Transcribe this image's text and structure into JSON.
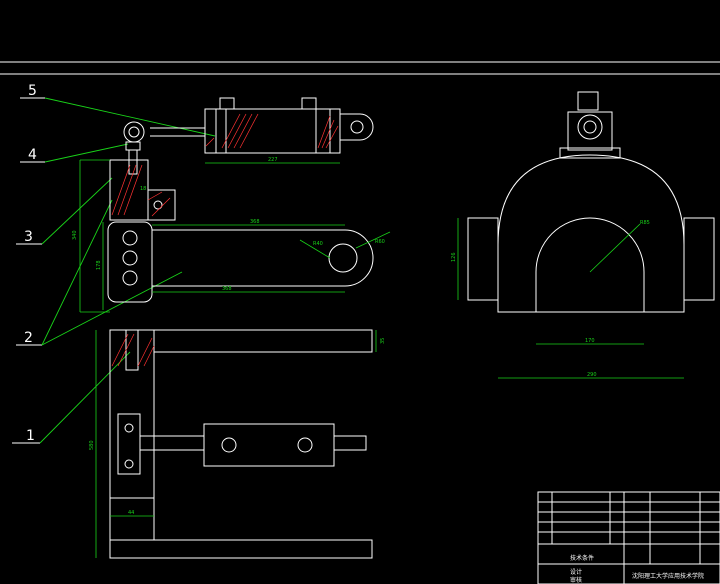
{
  "drawing": {
    "part_labels": [
      "5",
      "4",
      "3",
      "2",
      "1"
    ],
    "dimensions": {
      "cylinder_len": "227",
      "arm_len_top": "368",
      "arm_len_bottom": "368",
      "height_left": "340",
      "height_inner": "178",
      "arm_r_small": "R40",
      "arm_r_big": "R60",
      "plate_w": "44",
      "bottom_width": "44",
      "arch_inner_w": "170",
      "arch_outer_w": "290",
      "arch_h": "126",
      "arch_r": "R85",
      "clamp_h": "580",
      "bar_h": "35"
    }
  },
  "title_block": {
    "school": "沈阳理工大学应用技术学院",
    "label_left": "技术条件",
    "label_design": "设计",
    "label_check": "审核"
  },
  "colors": {
    "background": "#000000",
    "outline": "#ffffff",
    "dimension": "#19d219",
    "section": "#ff3333",
    "blue": "#3355ff"
  }
}
